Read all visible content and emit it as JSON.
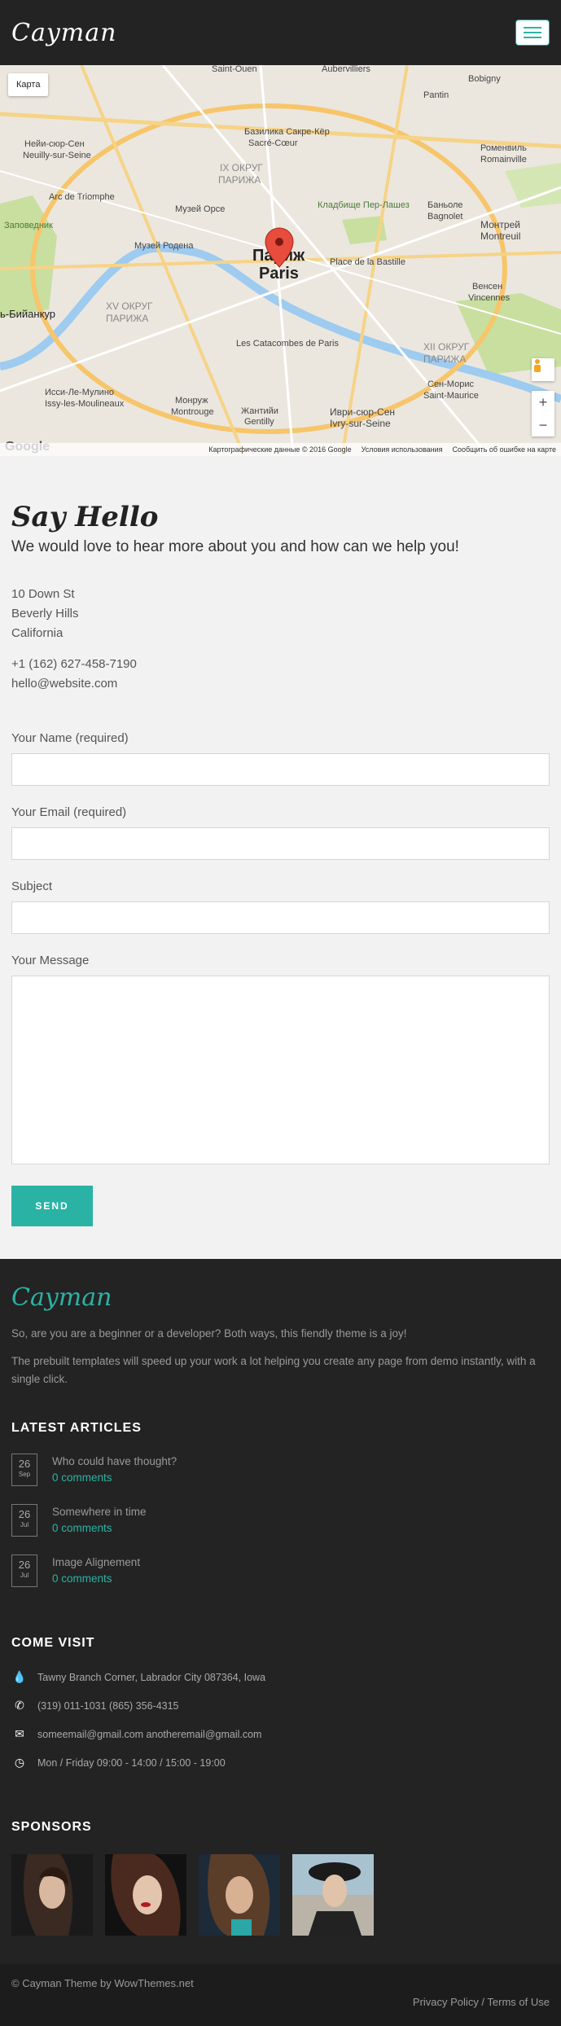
{
  "header": {
    "logo": "Cayman"
  },
  "map": {
    "type_button": "Карта",
    "center_label_ru": "Париж",
    "center_label_en": "Paris",
    "labels": [
      "Нейи-сюр-Сен",
      "Neuilly-sur-Seine",
      "Arc de Triomphe",
      "Базилика Сакре-Кёр",
      "Sacré-Cœur",
      "IX ОКРУГ ПАРИЖА",
      "Кладбище Пер-Лашез",
      "Музей Орсе",
      "Place de la Bastille",
      "Музей Родена",
      "XV ОКРУГ ПАРИЖА",
      "Les Catacombes de Paris",
      "Исси-Ле-Мулино",
      "Issy-les-Moulineaux",
      "Монруж",
      "Montrouge",
      "Жантийи",
      "Gentilly",
      "Иври-сюр-Сен",
      "Ivry-sur-Seine",
      "XII ОКРУГ ПАРИЖА",
      "Сен-Морис",
      "Saint-Maurice",
      "Монтрей",
      "Montreuil",
      "Венсен",
      "Vincennes",
      "Роменвиль",
      "Romainville",
      "Баньоле",
      "Bagnolet",
      "Bobigny",
      "Aubervilliers",
      "Булонь-Бийанкур",
      "Заповедник Булонь",
      "Saint-Ouen",
      "Pantin"
    ],
    "footer_data": "Картографические данные © 2016 Google",
    "footer_terms": "Условия использования",
    "footer_report": "Сообщить об ошибке на карте",
    "google": "Google",
    "zoom_in": "+",
    "zoom_out": "−"
  },
  "contact": {
    "title": "Say Hello",
    "subtitle": "We would love to hear more about you and how can we help you!",
    "address": [
      "10 Down St",
      "Beverly Hills",
      "California"
    ],
    "phone": "+1 (162) 627-458-7190",
    "email": "hello@website.com",
    "form": {
      "name_label": "Your Name (required)",
      "email_label": "Your Email (required)",
      "subject_label": "Subject",
      "message_label": "Your Message",
      "send": "SEND"
    }
  },
  "footer": {
    "logo": "Cayman",
    "text1": "So, are you are a beginner or a developer? Both ways, this fiendly theme is a joy!",
    "text2": "The prebuilt templates will speed up your work a lot helping you create any page from demo instantly, with a single click.",
    "latest_title": "LATEST ARTICLES",
    "articles": [
      {
        "day": "26",
        "month": "Sep",
        "title": "Who could have thought?",
        "comments": "0 comments"
      },
      {
        "day": "26",
        "month": "Jul",
        "title": "Somewhere in time",
        "comments": "0 comments"
      },
      {
        "day": "26",
        "month": "Jul",
        "title": "Image Alignement",
        "comments": "0 comments"
      }
    ],
    "visit_title": "COME VISIT",
    "visit": {
      "address": "Tawny Branch Corner, Labrador City 087364, Iowa",
      "phones": "(319) 011-1031 (865) 356-4315",
      "emails": "someemail@gmail.com anotheremail@gmail.com",
      "hours": "Mon / Friday 09:00 - 14:00 / 15:00 - 19:00"
    },
    "sponsors_title": "SPONSORS",
    "copyright": "© Cayman Theme by WowThemes.net",
    "legal": "Privacy Policy / Terms of Use"
  },
  "colors": {
    "accent": "#2ab3a5",
    "header_bg": "#232323",
    "footer_bg": "#232323",
    "bottom_bg": "#1c1c1c"
  }
}
